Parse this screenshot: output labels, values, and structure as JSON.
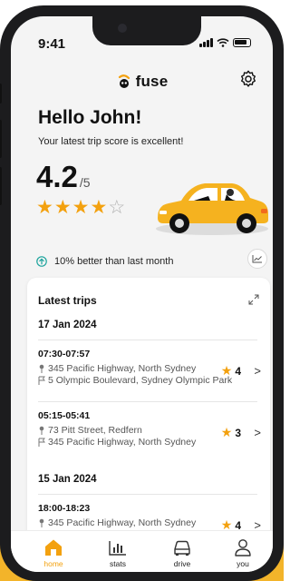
{
  "status": {
    "time": "9:41"
  },
  "brand": {
    "name": "fuse",
    "color": "#f3a10f"
  },
  "header": {
    "greeting": "Hello John!",
    "subtitle": "Your latest trip score is excellent!",
    "score": "4.2",
    "score_max": "/5",
    "stars_filled": 4,
    "stars_total": 5
  },
  "improvement": {
    "text": "10% better than last month"
  },
  "latest_trips": {
    "title": "Latest trips",
    "groups": [
      {
        "date": "17 Jan 2024",
        "trips": [
          {
            "time": "07:30-07:57",
            "from": "345 Pacific Highway, North Sydney",
            "to": "5 Olympic Boulevard, Sydney Olympic Park",
            "score": "4"
          },
          {
            "time": "05:15-05:41",
            "from": "73 Pitt Street, Redfern",
            "to": "345 Pacific Highway, North Sydney",
            "score": "3"
          }
        ]
      },
      {
        "date": "15 Jan 2024",
        "trips": [
          {
            "time": "18:00-18:23",
            "from": "345 Pacific Highway, North Sydney",
            "to": "",
            "score": "4"
          }
        ]
      }
    ]
  },
  "nav": {
    "items": [
      {
        "label": "home",
        "icon": "home-icon",
        "active": true
      },
      {
        "label": "stats",
        "icon": "stats-icon",
        "active": false
      },
      {
        "label": "drive",
        "icon": "car-icon",
        "active": false
      },
      {
        "label": "you",
        "icon": "user-icon",
        "active": false
      }
    ]
  }
}
